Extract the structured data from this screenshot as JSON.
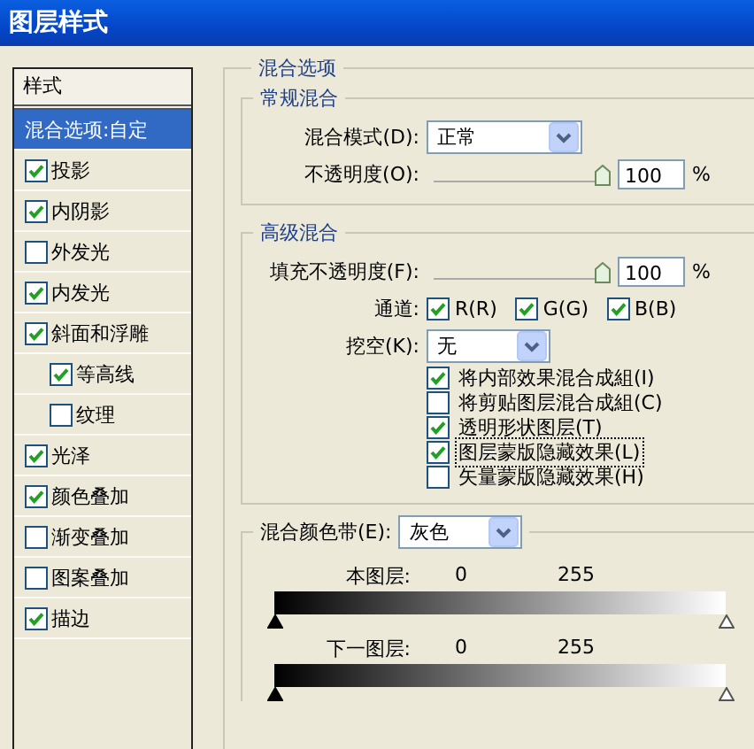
{
  "window": {
    "title": "图层样式"
  },
  "styles_panel": {
    "header": "样式",
    "items": [
      {
        "label": "混合选项:自定",
        "kind": "option",
        "selected": true
      },
      {
        "label": "投影",
        "kind": "effect",
        "checked": true,
        "selected": false
      },
      {
        "label": "内阴影",
        "kind": "effect",
        "checked": true,
        "selected": false
      },
      {
        "label": "外发光",
        "kind": "effect",
        "checked": false,
        "selected": false
      },
      {
        "label": "内发光",
        "kind": "effect",
        "checked": true,
        "selected": false
      },
      {
        "label": "斜面和浮雕",
        "kind": "effect",
        "checked": true,
        "selected": false
      },
      {
        "label": "等高线",
        "kind": "sub_effect",
        "checked": true,
        "selected": false
      },
      {
        "label": "纹理",
        "kind": "sub_effect",
        "checked": false,
        "selected": false
      },
      {
        "label": "光泽",
        "kind": "effect",
        "checked": true,
        "selected": false
      },
      {
        "label": "颜色叠加",
        "kind": "effect",
        "checked": true,
        "selected": false
      },
      {
        "label": "渐变叠加",
        "kind": "effect",
        "checked": false,
        "selected": false
      },
      {
        "label": "图案叠加",
        "kind": "effect",
        "checked": false,
        "selected": false
      },
      {
        "label": "描边",
        "kind": "effect",
        "checked": true,
        "selected": false
      }
    ]
  },
  "blending_options": {
    "legend": "混合选项",
    "general": {
      "legend": "常规混合",
      "mode": {
        "label": "混合模式(D):",
        "value": "正常"
      },
      "opacity": {
        "label": "不透明度(O):",
        "level": 1,
        "value": "100",
        "unit": "%"
      }
    },
    "advanced": {
      "legend": "高级混合",
      "fill_opacity": {
        "label": "填充不透明度(F):",
        "level": 1,
        "value": "100",
        "unit": "%"
      },
      "channels": {
        "label": "通道:",
        "items": [
          {
            "label": "R(R)",
            "checked": true
          },
          {
            "label": "G(G)",
            "checked": true
          },
          {
            "label": "B(B)",
            "checked": true
          }
        ]
      },
      "knockout": {
        "label": "挖空(K):",
        "value": "无"
      },
      "options": [
        {
          "label": "将内部效果混合成組(I)",
          "checked": true,
          "focused": false
        },
        {
          "label": "将剪贴图层混合成組(C)",
          "checked": false,
          "focused": false
        },
        {
          "label": "透明形状图层(T)",
          "checked": true,
          "focused": false
        },
        {
          "label": "图层蒙版隐藏效果(L)",
          "checked": true,
          "focused": true
        },
        {
          "label": "矢量蒙版隐藏效果(H)",
          "checked": false,
          "focused": false
        }
      ]
    },
    "blend_if": {
      "label": "混合颜色带(E):",
      "value": "灰色",
      "layers": [
        {
          "label": "本图层:",
          "low": "0",
          "high": "255"
        },
        {
          "label": "下一图层:",
          "low": "0",
          "high": "255"
        }
      ]
    }
  }
}
